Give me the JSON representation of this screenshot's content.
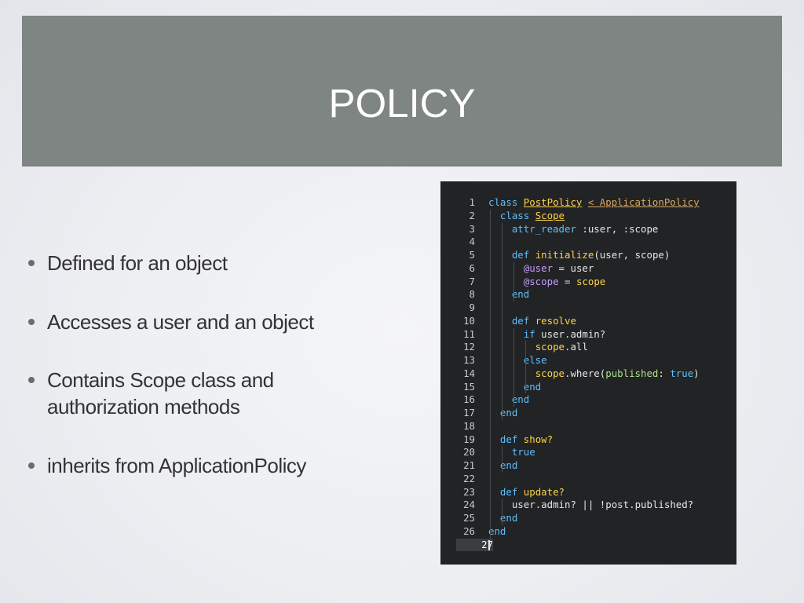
{
  "slide": {
    "title": "POLICY"
  },
  "bullets": [
    {
      "text": "Defined for an object"
    },
    {
      "text": "Accesses a user and an object"
    },
    {
      "text": "Contains Scope class and authorization methods"
    },
    {
      "text": "inherits from ApplicationPolicy"
    }
  ],
  "code": {
    "active_line": "27",
    "lines": [
      {
        "n": "1",
        "text": "class PostPolicy < ApplicationPolicy"
      },
      {
        "n": "2",
        "text": "  class Scope"
      },
      {
        "n": "3",
        "text": "    attr_reader :user, :scope"
      },
      {
        "n": "4",
        "text": ""
      },
      {
        "n": "5",
        "text": "    def initialize(user, scope)"
      },
      {
        "n": "6",
        "text": "      @user = user"
      },
      {
        "n": "7",
        "text": "      @scope = scope"
      },
      {
        "n": "8",
        "text": "    end"
      },
      {
        "n": "9",
        "text": ""
      },
      {
        "n": "10",
        "text": "    def resolve"
      },
      {
        "n": "11",
        "text": "      if user.admin?"
      },
      {
        "n": "12",
        "text": "        scope.all"
      },
      {
        "n": "13",
        "text": "      else"
      },
      {
        "n": "14",
        "text": "        scope.where(published: true)"
      },
      {
        "n": "15",
        "text": "      end"
      },
      {
        "n": "16",
        "text": "    end"
      },
      {
        "n": "17",
        "text": "  end"
      },
      {
        "n": "18",
        "text": ""
      },
      {
        "n": "19",
        "text": "  def show?"
      },
      {
        "n": "20",
        "text": "    true"
      },
      {
        "n": "21",
        "text": "  end"
      },
      {
        "n": "22",
        "text": ""
      },
      {
        "n": "23",
        "text": "  def update?"
      },
      {
        "n": "24",
        "text": "    user.admin? || !post.published?"
      },
      {
        "n": "25",
        "text": "  end"
      },
      {
        "n": "26",
        "text": "end"
      },
      {
        "n": "27",
        "text": ""
      }
    ]
  },
  "colors": {
    "banner": "#7f8582",
    "code_background": "#222324",
    "keyword": "#5fc0ff",
    "class_name": "#ffd24a",
    "parent_class": "#d9a75e",
    "instance_variable": "#c89cff",
    "literal": "#a9e18b"
  },
  "icons": {
    "bullet": "bullet-dot-icon",
    "cursor": "text-caret-icon"
  }
}
